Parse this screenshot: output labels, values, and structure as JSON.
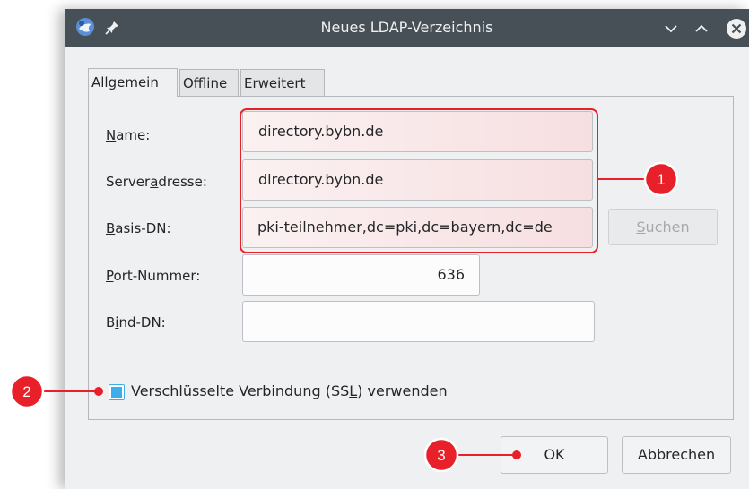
{
  "window": {
    "title": "Neues LDAP-Verzeichnis"
  },
  "tabs": [
    {
      "label": "Allgemein",
      "active": true
    },
    {
      "label": "Offline",
      "active": false
    },
    {
      "label": "Erweitert",
      "active": false
    }
  ],
  "form": {
    "name": {
      "mnemonic": "N",
      "label_rest": "ame:",
      "value": "directory.bybn.de"
    },
    "server": {
      "label_pre": "Server",
      "mnemonic": "a",
      "label_post": "dresse:",
      "value": "directory.bybn.de"
    },
    "basedn": {
      "mnemonic": "B",
      "label_rest": "asis-DN:",
      "value": "pki-teilnehmer,dc=pki,dc=bayern,dc=de"
    },
    "port": {
      "mnemonic": "P",
      "label_rest": "ort-Nummer:",
      "value": "636"
    },
    "binddn": {
      "label_pre": "B",
      "mnemonic": "i",
      "label_post": "nd-DN:",
      "value": ""
    },
    "search_button": {
      "mnemonic": "S",
      "label_rest": "uchen"
    },
    "ssl": {
      "label_pre": "Verschlüsselte Verbindung (SS",
      "mnemonic": "L",
      "label_post": ") verwenden",
      "checked": true
    }
  },
  "buttons": {
    "ok": "OK",
    "cancel": "Abbrechen"
  },
  "annotations": [
    {
      "number": "1"
    },
    {
      "number": "2"
    },
    {
      "number": "3"
    }
  ],
  "colors": {
    "titlebar": "#475057",
    "window_bg": "#eff0f1",
    "highlight": "#e8202a",
    "checkbox_accent": "#3daee9"
  },
  "icons": {
    "app": "thunderbird-icon",
    "pin": "pin-icon",
    "minimize": "chevron-down-icon",
    "maximize": "chevron-up-icon",
    "close": "close-icon"
  }
}
